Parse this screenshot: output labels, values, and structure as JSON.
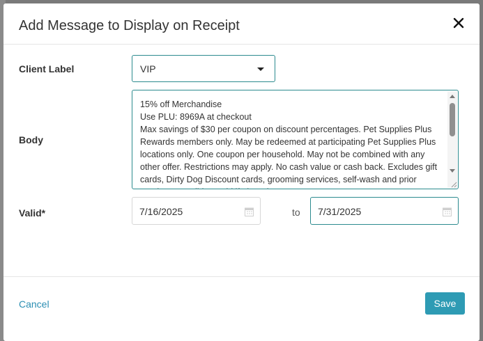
{
  "modal": {
    "title": "Add Message to Display on Receipt"
  },
  "form": {
    "client_label": {
      "label": "Client Label",
      "value": "VIP"
    },
    "body": {
      "label": "Body",
      "value": "15% off Merchandise\nUse PLU: 8969A at checkout\nMax savings of $30 per coupon on discount percentages. Pet Supplies Plus Rewards members only. May be redeemed at participating Pet Supplies Plus locations only. One coupon per household. May not be combined with any other offer. Restrictions may apply. No cash value or cash back. Excludes gift cards, Dirty Dog Discount cards, grooming services, self-wash and prior purchases. Valid ... Void if altered..."
    },
    "valid": {
      "label": "Valid*",
      "start": "7/16/2025",
      "to_label": "to",
      "end": "7/31/2025"
    }
  },
  "footer": {
    "cancel_label": "Cancel",
    "save_label": "Save"
  },
  "colors": {
    "accent": "#2b8a8e",
    "save_button": "#2e9bb4",
    "link": "#2c8fb3"
  },
  "icons": {
    "close": "close-icon",
    "dropdown": "chevron-down-icon",
    "calendar": "calendar-icon"
  }
}
